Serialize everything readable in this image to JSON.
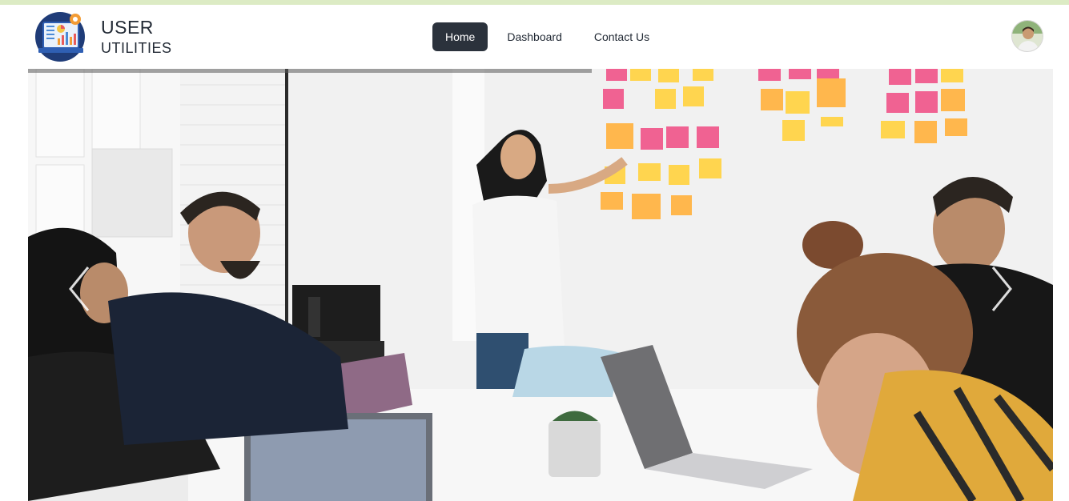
{
  "brand": {
    "title": "USER",
    "subtitle": "UTILITIES",
    "logo_icon": "dashboard-chart-logo-icon"
  },
  "nav": {
    "items": [
      {
        "label": "Home",
        "active": true
      },
      {
        "label": "Dashboard",
        "active": false
      },
      {
        "label": "Contact Us",
        "active": false
      }
    ]
  },
  "profile": {
    "avatar_icon": "user-avatar-icon"
  },
  "carousel": {
    "image_subject": "team-meeting-photo",
    "progress": 0.55,
    "prev_icon": "chevron-left-icon",
    "next_icon": "chevron-right-icon"
  },
  "colors": {
    "top_strip": "#dcebc4",
    "nav_active_bg": "#2b323c",
    "nav_text": "#222a35"
  }
}
